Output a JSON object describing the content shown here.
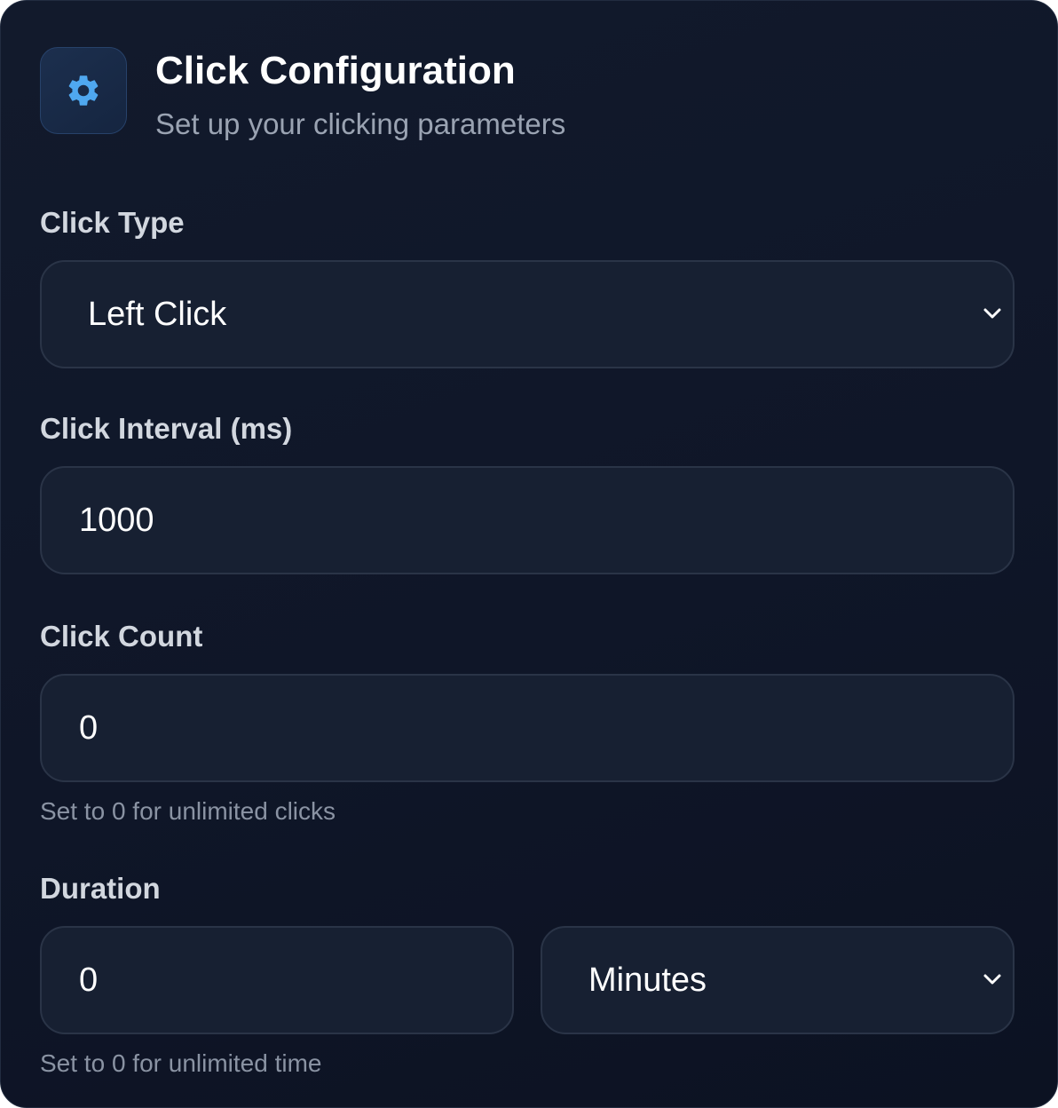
{
  "header": {
    "icon": "gear-icon",
    "title": "Click Configuration",
    "subtitle": "Set up your clicking parameters"
  },
  "click_type": {
    "label": "Click Type",
    "selected": "Left Click"
  },
  "click_interval": {
    "label": "Click Interval (ms)",
    "value": "1000"
  },
  "click_count": {
    "label": "Click Count",
    "value": "0",
    "hint": "Set to 0 for unlimited clicks"
  },
  "duration": {
    "label": "Duration",
    "value": "0",
    "unit_selected": "Minutes",
    "hint": "Set to 0 for unlimited time"
  },
  "colors": {
    "accent": "#4fa8f0",
    "panel_background": "#0f1628",
    "field_background": "#172032",
    "field_border": "#2a3447"
  }
}
